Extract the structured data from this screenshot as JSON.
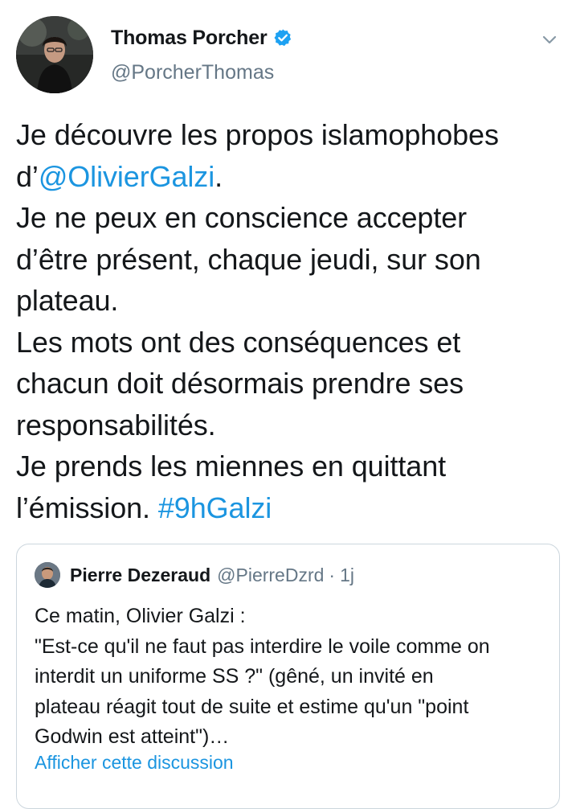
{
  "author": {
    "display_name": "Thomas Porcher",
    "handle": "@PorcherThomas",
    "verified": true
  },
  "tweet": {
    "text_lines": [
      {
        "text": "Je découvre les propos islamophobes"
      },
      {
        "prefix": "d’",
        "mention": "@OlivierGalzi",
        "suffix": "."
      },
      {
        "text": "Je ne peux en conscience accepter"
      },
      {
        "text": "d’être présent, chaque jeudi, sur son"
      },
      {
        "text": "plateau."
      },
      {
        "text": "Les mots ont des conséquences et"
      },
      {
        "text": "chacun doit désormais prendre ses"
      },
      {
        "text": "responsabilités."
      },
      {
        "text": "Je prends les miennes en quittant"
      },
      {
        "prefix": "l’émission. ",
        "hashtag": "#9hGalzi"
      }
    ]
  },
  "quoted_tweet": {
    "display_name": "Pierre Dezeraud",
    "handle": "@PierreDzrd",
    "separator": "·",
    "time": "1j",
    "text_lines": [
      "Ce matin, Olivier Galzi :",
      "\"Est-ce qu'il ne faut pas interdire le voile comme on",
      "interdit un uniforme SS ?\" (gêné, un invité en",
      "plateau réagit tout de suite et estime qu'un \"point",
      "Godwin est atteint\")…"
    ],
    "show_thread_label": "Afficher cette discussion"
  },
  "icons": {
    "verified": "verified-badge-icon",
    "menu": "chevron-down-icon"
  },
  "colors": {
    "link": "#1b95e0",
    "secondary_text": "#657786",
    "primary_text": "#14171a",
    "border": "#ccd6dd",
    "verified": "#1da1f2"
  }
}
